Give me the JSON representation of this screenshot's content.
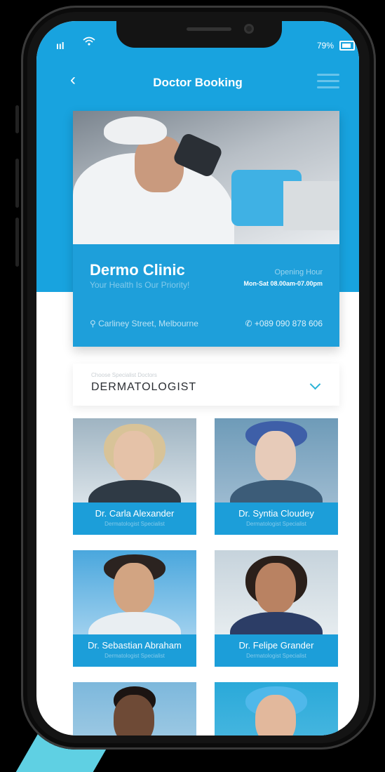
{
  "status_bar": {
    "signal": "ııl",
    "battery_percent": "79%"
  },
  "header": {
    "title": "Doctor Booking",
    "back_icon": "‹"
  },
  "clinic": {
    "name": "Dermo Clinic",
    "tagline": "Your Health Is Our Priority!",
    "opening_label": "Opening Hour",
    "opening_hours": "Mon-Sat 08.00am-07.00pm",
    "address": "Carliney Street, Melbourne",
    "phone": "+089 090 878 606"
  },
  "specialist_select": {
    "label": "Choose Specialist Doctors",
    "value": "DERMATOLOGIST"
  },
  "doctors": [
    {
      "name": "Dr. Carla Alexander",
      "specialty": "Dermatologist Specialist"
    },
    {
      "name": "Dr. Syntia Cloudey",
      "specialty": "Dermatologist Specialist"
    },
    {
      "name": "Dr. Sebastian Abraham",
      "specialty": "Dermatologist Specialist"
    },
    {
      "name": "Dr. Felipe Grander",
      "specialty": "Dermatologist Specialist"
    }
  ],
  "colors": {
    "primary": "#18a3df",
    "accent": "#2ab3d6",
    "teal_corner": "#5fd0e3"
  }
}
